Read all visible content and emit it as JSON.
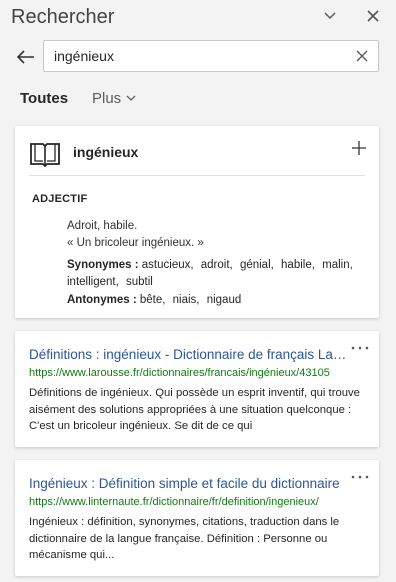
{
  "pane": {
    "title": "Rechercher"
  },
  "search": {
    "query": "ingénieux",
    "placeholder": ""
  },
  "tabs": [
    {
      "label": "Toutes"
    },
    {
      "label": "Plus"
    }
  ],
  "dictionary": {
    "word": "ingénieux",
    "part_of_speech": "ADJECTIF",
    "definition": "Adroit, habile.",
    "example": "« Un bricoleur ingénieux. »",
    "synonyms_label": "Synonymes :",
    "synonyms": [
      "astucieux,",
      "adroit,",
      "génial,",
      "habile,",
      "malin,",
      "intelligent,",
      "subtil"
    ],
    "antonyms_label": "Antonymes :",
    "antonyms": [
      "bête,",
      "niais,",
      "nigaud"
    ]
  },
  "results": [
    {
      "title": "Définitions : ingénieux - Dictionnaire de français Larousse",
      "url": "https://www.larousse.fr/dictionnaires/francais/ingénieux/43105",
      "snippet": "Définitions de ingénieux. Qui possède un esprit inventif, qui trouve aisément des solutions appropriées à une situation quelconque : C'est un bricoleur ingénieux. Se dit de ce qui"
    },
    {
      "title": "Ingénieux : Définition simple et facile du dictionnaire",
      "url": "https://www.linternaute.fr/dictionnaire/fr/definition/ingenieux/",
      "snippet": "Ingénieux : définition, synonymes, citations, traduction dans le dictionnaire de la langue française. Définition : Personne ou mécanisme qui..."
    }
  ]
}
